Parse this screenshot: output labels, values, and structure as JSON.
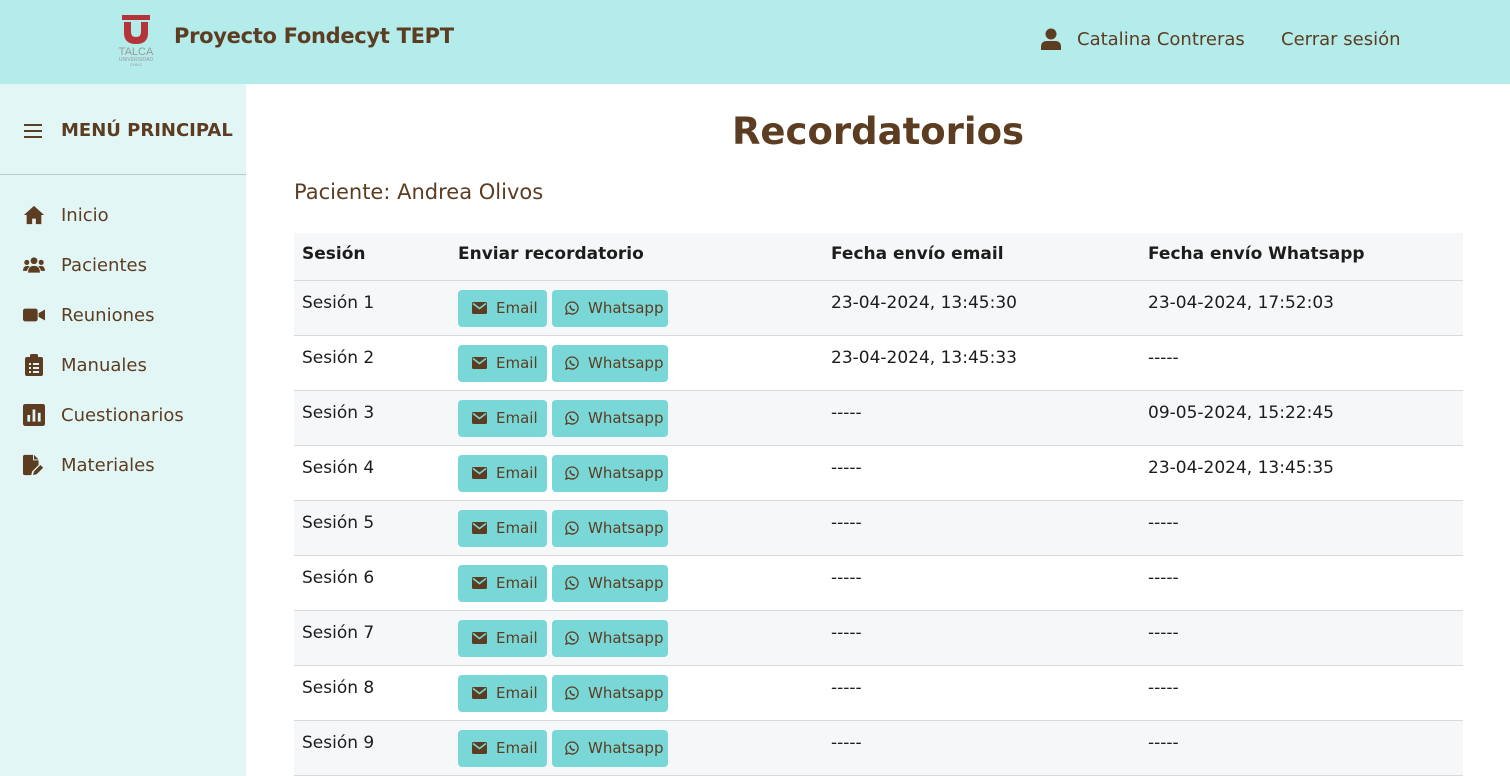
{
  "header": {
    "logo_text": "TALCA",
    "logo_subtext": "UNIVERSIDAD",
    "logo_subtext2": "CHILE",
    "title": "Proyecto Fondecyt TEPT",
    "user_name": "Catalina Contreras",
    "logout_label": "Cerrar sesión",
    "logo_color": "#b3353a",
    "background": "#b4ebeb"
  },
  "sidebar": {
    "menu_label": "MENÚ PRINCIPAL",
    "items": [
      {
        "label": "Inicio",
        "icon": "home-icon"
      },
      {
        "label": "Pacientes",
        "icon": "users-icon"
      },
      {
        "label": "Reuniones",
        "icon": "video-icon"
      },
      {
        "label": "Manuales",
        "icon": "clipboard-icon"
      },
      {
        "label": "Cuestionarios",
        "icon": "chart-icon"
      },
      {
        "label": "Materiales",
        "icon": "file-edit-icon"
      }
    ]
  },
  "main": {
    "title": "Recordatorios",
    "patient_label": "Paciente: Andrea Olivos",
    "table": {
      "headers": [
        "Sesión",
        "Enviar recordatorio",
        "Fecha envío email",
        "Fecha envío Whatsapp"
      ],
      "email_button_label": "Email",
      "whatsapp_button_label": "Whatsapp",
      "rows": [
        {
          "session": "Sesión 1",
          "email_date": "23-04-2024, 13:45:30",
          "whatsapp_date": "23-04-2024, 17:52:03"
        },
        {
          "session": "Sesión 2",
          "email_date": "23-04-2024, 13:45:33",
          "whatsapp_date": "-----"
        },
        {
          "session": "Sesión 3",
          "email_date": "-----",
          "whatsapp_date": "09-05-2024, 15:22:45"
        },
        {
          "session": "Sesión 4",
          "email_date": "-----",
          "whatsapp_date": "23-04-2024, 13:45:35"
        },
        {
          "session": "Sesión 5",
          "email_date": "-----",
          "whatsapp_date": "-----"
        },
        {
          "session": "Sesión 6",
          "email_date": "-----",
          "whatsapp_date": "-----"
        },
        {
          "session": "Sesión 7",
          "email_date": "-----",
          "whatsapp_date": "-----"
        },
        {
          "session": "Sesión 8",
          "email_date": "-----",
          "whatsapp_date": "-----"
        },
        {
          "session": "Sesión 9",
          "email_date": "-----",
          "whatsapp_date": "-----"
        }
      ]
    }
  },
  "colors": {
    "text_brown": "#5c3d22",
    "button_teal": "#79d7d7",
    "sidebar_bg": "#e3f6f6"
  }
}
